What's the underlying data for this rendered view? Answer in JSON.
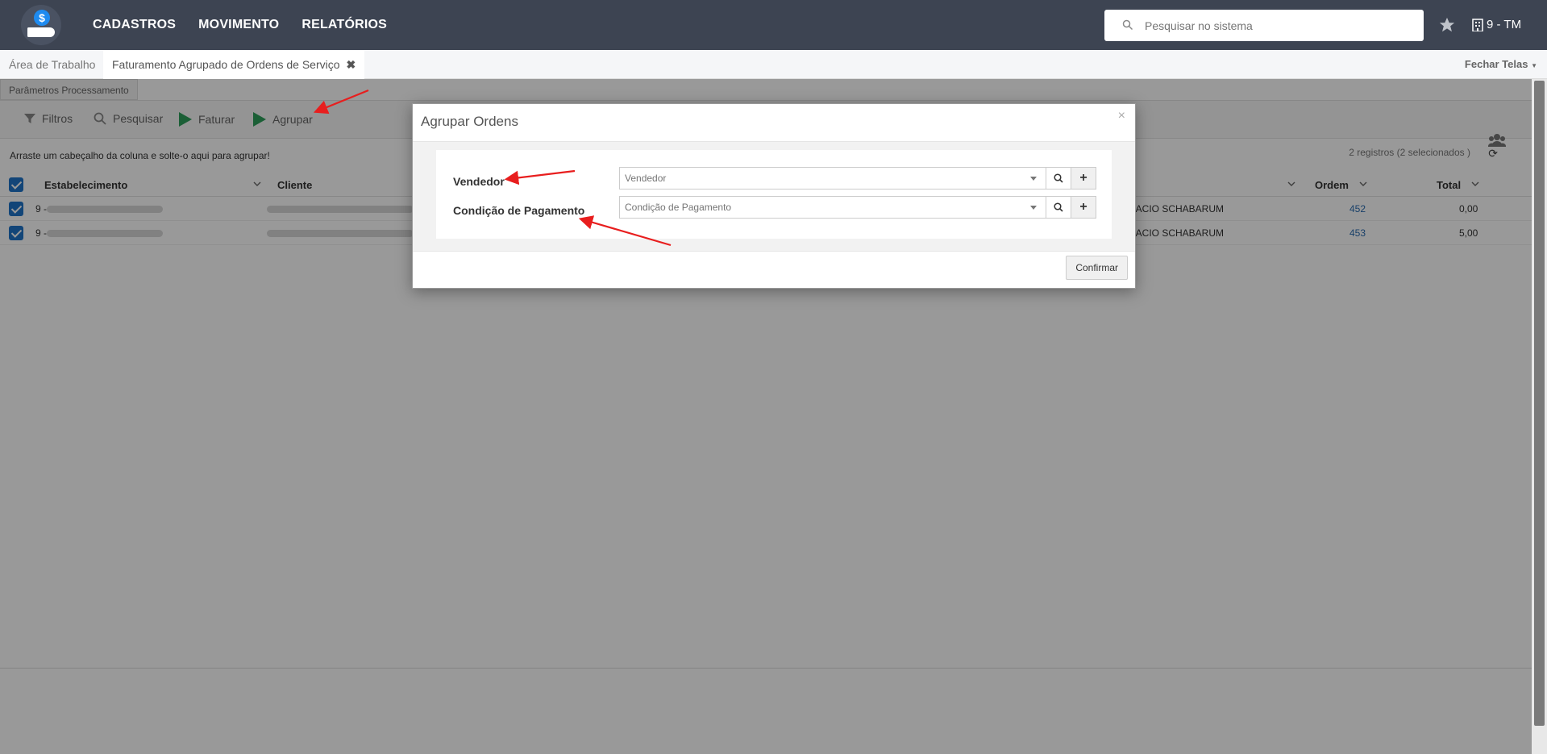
{
  "header": {
    "nav": [
      "CADASTROS",
      "MOVIMENTO",
      "RELATÓRIOS"
    ],
    "search_placeholder": "Pesquisar no sistema",
    "company": "9 - TM",
    "logo_symbol": "$"
  },
  "tabs": {
    "items": [
      {
        "label": "Área de Trabalho"
      },
      {
        "label": "Faturamento Agrupado de Ordens de Serviço",
        "close": "✖"
      }
    ],
    "fechar_telas": "Fechar Telas"
  },
  "page": {
    "subtab": "Parâmetros Processamento",
    "toolbar": {
      "filtros": "Filtros",
      "pesquisar": "Pesquisar",
      "faturar": "Faturar",
      "agrupar": "Agrupar"
    },
    "group_hint": "Arraste um cabeçalho da coluna e solte-o aqui para agrupar!",
    "records": "2 registros (2 selecionados )",
    "columns": {
      "estabelecimento": "Estabelecimento",
      "cliente": "Cliente",
      "ordem": "Ordem",
      "total": "Total"
    },
    "rows": [
      {
        "estab_prefix": "9 -",
        "vendedor": "CACIO SCHABARUM",
        "ordem": "452",
        "total": "0,00"
      },
      {
        "estab_prefix": "9 -",
        "vendedor": "CACIO SCHABARUM",
        "ordem": "453",
        "total": "5,00"
      }
    ]
  },
  "modal": {
    "title": "Agrupar Ordens",
    "close": "×",
    "fields": [
      {
        "label": "Vendedor",
        "placeholder": "Vendedor"
      },
      {
        "label": "Condição de Pagamento",
        "placeholder": "Condição de Pagamento"
      }
    ],
    "plus": "+",
    "confirm": "Confirmar"
  },
  "colors": {
    "nav_bg": "#3d4452",
    "accent": "#1e73c8",
    "play_green": "#2e9e5b",
    "annotation_red": "#e81e1e"
  }
}
